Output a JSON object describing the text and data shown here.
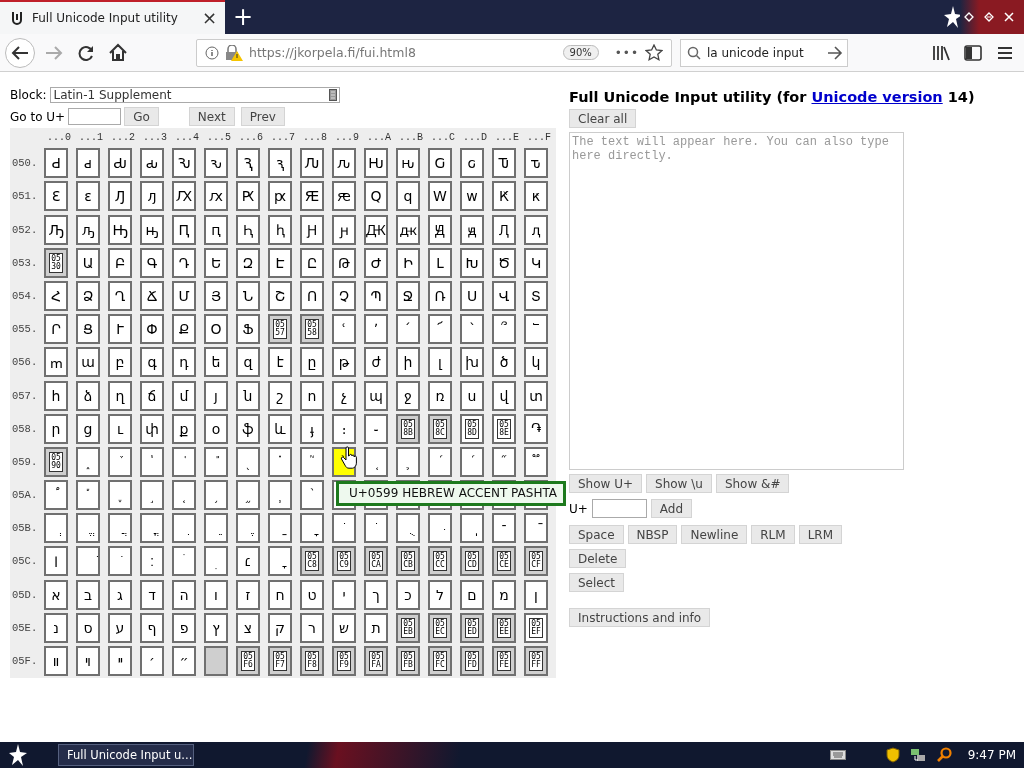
{
  "browser": {
    "tab": {
      "title": "Full Unicode Input utility",
      "close": "×",
      "selected": true
    },
    "new_tab": "+",
    "url": "https://jkorpela.fi/fui.html8",
    "zoom": "90%",
    "page_actions": "•••",
    "search": {
      "value": "la unicode input"
    }
  },
  "block": {
    "label": "Block:",
    "value": "Latin-1 Supplement"
  },
  "goto": {
    "label": "Go to U+",
    "button": "Go"
  },
  "nav_buttons": [
    "Next",
    "Prev"
  ],
  "grid": {
    "column_headers": [
      "...0",
      "...1",
      "...2",
      "...3",
      "...4",
      "...5",
      "...6",
      "...7",
      "...8",
      "...9",
      "...A",
      "...B",
      "...C",
      "...D",
      "...E",
      "...F"
    ],
    "rows": [
      {
        "label": "050.",
        "cells": [
          {
            "kind": "char",
            "text": "Ԁ",
            "hovered": false
          },
          {
            "kind": "char",
            "text": "ԁ",
            "hovered": false
          },
          {
            "kind": "char",
            "text": "Ԃ",
            "hovered": false
          },
          {
            "kind": "char",
            "text": "ԃ",
            "hovered": false
          },
          {
            "kind": "char",
            "text": "Ԅ",
            "hovered": false
          },
          {
            "kind": "char",
            "text": "ԅ",
            "hovered": false
          },
          {
            "kind": "char",
            "text": "Ԇ",
            "hovered": false
          },
          {
            "kind": "char",
            "text": "ԇ",
            "hovered": false
          },
          {
            "kind": "char",
            "text": "Ԉ",
            "hovered": false
          },
          {
            "kind": "char",
            "text": "ԉ",
            "hovered": false
          },
          {
            "kind": "char",
            "text": "Ԋ",
            "hovered": false
          },
          {
            "kind": "char",
            "text": "ԋ",
            "hovered": false
          },
          {
            "kind": "char",
            "text": "Ԍ",
            "hovered": false
          },
          {
            "kind": "char",
            "text": "ԍ",
            "hovered": false
          },
          {
            "kind": "char",
            "text": "Ԏ",
            "hovered": false
          },
          {
            "kind": "char",
            "text": "ԏ",
            "hovered": false
          }
        ]
      },
      {
        "label": "051.",
        "cells": [
          {
            "kind": "char",
            "text": "Ԑ",
            "hovered": false
          },
          {
            "kind": "char",
            "text": "ԑ",
            "hovered": false
          },
          {
            "kind": "char",
            "text": "Ԓ",
            "hovered": false
          },
          {
            "kind": "char",
            "text": "ԓ",
            "hovered": false
          },
          {
            "kind": "char",
            "text": "Ԕ",
            "hovered": false
          },
          {
            "kind": "char",
            "text": "ԕ",
            "hovered": false
          },
          {
            "kind": "char",
            "text": "Ԗ",
            "hovered": false
          },
          {
            "kind": "char",
            "text": "ԗ",
            "hovered": false
          },
          {
            "kind": "char",
            "text": "Ԙ",
            "hovered": false
          },
          {
            "kind": "char",
            "text": "ԙ",
            "hovered": false
          },
          {
            "kind": "char",
            "text": "Ԛ",
            "hovered": false
          },
          {
            "kind": "char",
            "text": "ԛ",
            "hovered": false
          },
          {
            "kind": "char",
            "text": "Ԝ",
            "hovered": false
          },
          {
            "kind": "char",
            "text": "ԝ",
            "hovered": false
          },
          {
            "kind": "char",
            "text": "Ԟ",
            "hovered": false
          },
          {
            "kind": "char",
            "text": "ԟ",
            "hovered": false
          }
        ]
      },
      {
        "label": "052.",
        "cells": [
          {
            "kind": "char",
            "text": "Ԡ",
            "hovered": false
          },
          {
            "kind": "char",
            "text": "ԡ",
            "hovered": false
          },
          {
            "kind": "char",
            "text": "Ԣ",
            "hovered": false
          },
          {
            "kind": "char",
            "text": "ԣ",
            "hovered": false
          },
          {
            "kind": "char",
            "text": "Ԥ",
            "hovered": false
          },
          {
            "kind": "char",
            "text": "ԥ",
            "hovered": false
          },
          {
            "kind": "char",
            "text": "Ԧ",
            "hovered": false
          },
          {
            "kind": "char",
            "text": "ԧ",
            "hovered": false
          },
          {
            "kind": "char",
            "text": "Ԩ",
            "hovered": false
          },
          {
            "kind": "char",
            "text": "ԩ",
            "hovered": false
          },
          {
            "kind": "char",
            "text": "Ԫ",
            "hovered": false
          },
          {
            "kind": "char",
            "text": "ԫ",
            "hovered": false
          },
          {
            "kind": "char",
            "text": "Ԭ",
            "hovered": false
          },
          {
            "kind": "char",
            "text": "ԭ",
            "hovered": false
          },
          {
            "kind": "char",
            "text": "Ԯ",
            "hovered": false
          },
          {
            "kind": "char",
            "text": "ԯ",
            "hovered": false
          }
        ]
      },
      {
        "label": "053.",
        "cells": [
          {
            "kind": "unassigned",
            "text": "05 30",
            "hovered": false
          },
          {
            "kind": "char",
            "text": "Ա",
            "hovered": false
          },
          {
            "kind": "char",
            "text": "Բ",
            "hovered": false
          },
          {
            "kind": "char",
            "text": "Գ",
            "hovered": false
          },
          {
            "kind": "char",
            "text": "Դ",
            "hovered": false
          },
          {
            "kind": "char",
            "text": "Ե",
            "hovered": false
          },
          {
            "kind": "char",
            "text": "Զ",
            "hovered": false
          },
          {
            "kind": "char",
            "text": "Է",
            "hovered": false
          },
          {
            "kind": "char",
            "text": "Ը",
            "hovered": false
          },
          {
            "kind": "char",
            "text": "Թ",
            "hovered": false
          },
          {
            "kind": "char",
            "text": "Ժ",
            "hovered": false
          },
          {
            "kind": "char",
            "text": "Ի",
            "hovered": false
          },
          {
            "kind": "char",
            "text": "Լ",
            "hovered": false
          },
          {
            "kind": "char",
            "text": "Խ",
            "hovered": false
          },
          {
            "kind": "char",
            "text": "Ծ",
            "hovered": false
          },
          {
            "kind": "char",
            "text": "Կ",
            "hovered": false
          }
        ]
      },
      {
        "label": "054.",
        "cells": [
          {
            "kind": "char",
            "text": "Հ",
            "hovered": false
          },
          {
            "kind": "char",
            "text": "Ձ",
            "hovered": false
          },
          {
            "kind": "char",
            "text": "Ղ",
            "hovered": false
          },
          {
            "kind": "char",
            "text": "Ճ",
            "hovered": false
          },
          {
            "kind": "char",
            "text": "Մ",
            "hovered": false
          },
          {
            "kind": "char",
            "text": "Յ",
            "hovered": false
          },
          {
            "kind": "char",
            "text": "Ն",
            "hovered": false
          },
          {
            "kind": "char",
            "text": "Շ",
            "hovered": false
          },
          {
            "kind": "char",
            "text": "Ո",
            "hovered": false
          },
          {
            "kind": "char",
            "text": "Չ",
            "hovered": false
          },
          {
            "kind": "char",
            "text": "Պ",
            "hovered": false
          },
          {
            "kind": "char",
            "text": "Ջ",
            "hovered": false
          },
          {
            "kind": "char",
            "text": "Ռ",
            "hovered": false
          },
          {
            "kind": "char",
            "text": "Ս",
            "hovered": false
          },
          {
            "kind": "char",
            "text": "Վ",
            "hovered": false
          },
          {
            "kind": "char",
            "text": "Տ",
            "hovered": false
          }
        ]
      },
      {
        "label": "055.",
        "cells": [
          {
            "kind": "char",
            "text": "Ր",
            "hovered": false
          },
          {
            "kind": "char",
            "text": "Ց",
            "hovered": false
          },
          {
            "kind": "char",
            "text": "Ւ",
            "hovered": false
          },
          {
            "kind": "char",
            "text": "Փ",
            "hovered": false
          },
          {
            "kind": "char",
            "text": "Ք",
            "hovered": false
          },
          {
            "kind": "char",
            "text": "Օ",
            "hovered": false
          },
          {
            "kind": "char",
            "text": "Ֆ",
            "hovered": false
          },
          {
            "kind": "unassigned",
            "text": "05 57",
            "hovered": false
          },
          {
            "kind": "unassigned",
            "text": "05 58",
            "hovered": false
          },
          {
            "kind": "char",
            "text": "ՙ",
            "hovered": false
          },
          {
            "kind": "char",
            "text": "՚",
            "hovered": false
          },
          {
            "kind": "char",
            "text": "՛",
            "hovered": false
          },
          {
            "kind": "char",
            "text": "՜",
            "hovered": false
          },
          {
            "kind": "char",
            "text": "՝",
            "hovered": false
          },
          {
            "kind": "char",
            "text": "՞",
            "hovered": false
          },
          {
            "kind": "char",
            "text": "՟",
            "hovered": false
          }
        ]
      },
      {
        "label": "056.",
        "cells": [
          {
            "kind": "char",
            "text": "ՠ",
            "hovered": false
          },
          {
            "kind": "char",
            "text": "ա",
            "hovered": false
          },
          {
            "kind": "char",
            "text": "բ",
            "hovered": false
          },
          {
            "kind": "char",
            "text": "գ",
            "hovered": false
          },
          {
            "kind": "char",
            "text": "դ",
            "hovered": false
          },
          {
            "kind": "char",
            "text": "ե",
            "hovered": false
          },
          {
            "kind": "char",
            "text": "զ",
            "hovered": false
          },
          {
            "kind": "char",
            "text": "է",
            "hovered": false
          },
          {
            "kind": "char",
            "text": "ը",
            "hovered": false
          },
          {
            "kind": "char",
            "text": "թ",
            "hovered": false
          },
          {
            "kind": "char",
            "text": "ժ",
            "hovered": false
          },
          {
            "kind": "char",
            "text": "ի",
            "hovered": false
          },
          {
            "kind": "char",
            "text": "լ",
            "hovered": false
          },
          {
            "kind": "char",
            "text": "խ",
            "hovered": false
          },
          {
            "kind": "char",
            "text": "ծ",
            "hovered": false
          },
          {
            "kind": "char",
            "text": "կ",
            "hovered": false
          }
        ]
      },
      {
        "label": "057.",
        "cells": [
          {
            "kind": "char",
            "text": "հ",
            "hovered": false
          },
          {
            "kind": "char",
            "text": "ձ",
            "hovered": false
          },
          {
            "kind": "char",
            "text": "ղ",
            "hovered": false
          },
          {
            "kind": "char",
            "text": "ճ",
            "hovered": false
          },
          {
            "kind": "char",
            "text": "մ",
            "hovered": false
          },
          {
            "kind": "char",
            "text": "յ",
            "hovered": false
          },
          {
            "kind": "char",
            "text": "ն",
            "hovered": false
          },
          {
            "kind": "char",
            "text": "շ",
            "hovered": false
          },
          {
            "kind": "char",
            "text": "ո",
            "hovered": false
          },
          {
            "kind": "char",
            "text": "չ",
            "hovered": false
          },
          {
            "kind": "char",
            "text": "պ",
            "hovered": false
          },
          {
            "kind": "char",
            "text": "ջ",
            "hovered": false
          },
          {
            "kind": "char",
            "text": "ռ",
            "hovered": false
          },
          {
            "kind": "char",
            "text": "ս",
            "hovered": false
          },
          {
            "kind": "char",
            "text": "վ",
            "hovered": false
          },
          {
            "kind": "char",
            "text": "տ",
            "hovered": false
          }
        ]
      },
      {
        "label": "058.",
        "cells": [
          {
            "kind": "char",
            "text": "ր",
            "hovered": false
          },
          {
            "kind": "char",
            "text": "ց",
            "hovered": false
          },
          {
            "kind": "char",
            "text": "ւ",
            "hovered": false
          },
          {
            "kind": "char",
            "text": "փ",
            "hovered": false
          },
          {
            "kind": "char",
            "text": "ք",
            "hovered": false
          },
          {
            "kind": "char",
            "text": "օ",
            "hovered": false
          },
          {
            "kind": "char",
            "text": "ֆ",
            "hovered": false
          },
          {
            "kind": "char",
            "text": "և",
            "hovered": false
          },
          {
            "kind": "char",
            "text": "ֈ",
            "hovered": false
          },
          {
            "kind": "char",
            "text": "։",
            "hovered": false
          },
          {
            "kind": "char",
            "text": "֊",
            "hovered": false
          },
          {
            "kind": "unassigned",
            "text": "05 8B",
            "hovered": false
          },
          {
            "kind": "unassigned",
            "text": "05 8C",
            "hovered": false
          },
          {
            "kind": "hex",
            "text": "05 8D",
            "hovered": false
          },
          {
            "kind": "hex",
            "text": "05 8E",
            "hovered": false
          },
          {
            "kind": "char",
            "text": "֏",
            "hovered": false
          }
        ]
      },
      {
        "label": "059.",
        "cells": [
          {
            "kind": "unassigned",
            "text": "05 90",
            "hovered": false
          },
          {
            "kind": "char",
            "text": "֑",
            "hovered": false
          },
          {
            "kind": "char",
            "text": "֒",
            "hovered": false
          },
          {
            "kind": "char",
            "text": "֓",
            "hovered": false
          },
          {
            "kind": "char",
            "text": "֔",
            "hovered": false
          },
          {
            "kind": "char",
            "text": "֕",
            "hovered": false
          },
          {
            "kind": "char",
            "text": "֖",
            "hovered": false
          },
          {
            "kind": "char",
            "text": "֗",
            "hovered": false
          },
          {
            "kind": "char",
            "text": "֘",
            "hovered": false
          },
          {
            "kind": "char",
            "text": "֙",
            "hovered": true
          },
          {
            "kind": "char",
            "text": "֚",
            "hovered": false
          },
          {
            "kind": "char",
            "text": "֛",
            "hovered": false
          },
          {
            "kind": "char",
            "text": "֜",
            "hovered": false
          },
          {
            "kind": "char",
            "text": "֝",
            "hovered": false
          },
          {
            "kind": "char",
            "text": "֞",
            "hovered": false
          },
          {
            "kind": "char",
            "text": "֟",
            "hovered": false
          }
        ]
      },
      {
        "label": "05A.",
        "cells": [
          {
            "kind": "char",
            "text": "֠",
            "hovered": false
          },
          {
            "kind": "char",
            "text": "֡",
            "hovered": false
          },
          {
            "kind": "char",
            "text": "֢",
            "hovered": false
          },
          {
            "kind": "char",
            "text": "֣",
            "hovered": false
          },
          {
            "kind": "char",
            "text": "֤",
            "hovered": false
          },
          {
            "kind": "char",
            "text": "֥",
            "hovered": false
          },
          {
            "kind": "char",
            "text": "֦",
            "hovered": false
          },
          {
            "kind": "char",
            "text": "֧",
            "hovered": false
          },
          {
            "kind": "char",
            "text": "֨",
            "hovered": false
          },
          {
            "kind": "covered",
            "hovered": false
          },
          {
            "kind": "covered",
            "hovered": false
          },
          {
            "kind": "covered",
            "hovered": false
          },
          {
            "kind": "covered",
            "hovered": false
          },
          {
            "kind": "covered",
            "hovered": false
          },
          {
            "kind": "covered",
            "hovered": false
          },
          {
            "kind": "covered",
            "hovered": false
          }
        ]
      },
      {
        "label": "05B.",
        "cells": [
          {
            "kind": "char",
            "text": "ְ",
            "hovered": false
          },
          {
            "kind": "char",
            "text": "ֱ",
            "hovered": false
          },
          {
            "kind": "char",
            "text": "ֲ",
            "hovered": false
          },
          {
            "kind": "char",
            "text": "ֳ",
            "hovered": false
          },
          {
            "kind": "char",
            "text": "ִ",
            "hovered": false
          },
          {
            "kind": "char",
            "text": "ֵ",
            "hovered": false
          },
          {
            "kind": "char",
            "text": "ֶ",
            "hovered": false
          },
          {
            "kind": "char",
            "text": "ַ",
            "hovered": false
          },
          {
            "kind": "char",
            "text": "ָ",
            "hovered": false
          },
          {
            "kind": "char",
            "text": "ֹ",
            "hovered": false
          },
          {
            "kind": "char",
            "text": "ֺ",
            "hovered": false
          },
          {
            "kind": "char",
            "text": "ֻ",
            "hovered": false
          },
          {
            "kind": "char",
            "text": "ּ",
            "hovered": false
          },
          {
            "kind": "char",
            "text": "ֽ",
            "hovered": false
          },
          {
            "kind": "char",
            "text": "־",
            "hovered": false
          },
          {
            "kind": "char",
            "text": "ֿ",
            "hovered": false
          }
        ]
      },
      {
        "label": "05C.",
        "cells": [
          {
            "kind": "char",
            "text": "׀",
            "hovered": false
          },
          {
            "kind": "char",
            "text": "ׁ",
            "hovered": false
          },
          {
            "kind": "char",
            "text": "ׂ",
            "hovered": false
          },
          {
            "kind": "char",
            "text": "׃",
            "hovered": false
          },
          {
            "kind": "char",
            "text": "ׄ",
            "hovered": false
          },
          {
            "kind": "char",
            "text": "ׅ",
            "hovered": false
          },
          {
            "kind": "char",
            "text": "׆",
            "hovered": false
          },
          {
            "kind": "char",
            "text": "ׇ",
            "hovered": false
          },
          {
            "kind": "unassigned",
            "text": "05 C8",
            "hovered": false
          },
          {
            "kind": "unassigned",
            "text": "05 C9",
            "hovered": false
          },
          {
            "kind": "unassigned",
            "text": "05 CA",
            "hovered": false
          },
          {
            "kind": "unassigned",
            "text": "05 CB",
            "hovered": false
          },
          {
            "kind": "unassigned",
            "text": "05 CC",
            "hovered": false
          },
          {
            "kind": "unassigned",
            "text": "05 CD",
            "hovered": false
          },
          {
            "kind": "unassigned",
            "text": "05 CE",
            "hovered": false
          },
          {
            "kind": "unassigned",
            "text": "05 CF",
            "hovered": false
          }
        ]
      },
      {
        "label": "05D.",
        "cells": [
          {
            "kind": "char",
            "text": "א",
            "hovered": false
          },
          {
            "kind": "char",
            "text": "ב",
            "hovered": false
          },
          {
            "kind": "char",
            "text": "ג",
            "hovered": false
          },
          {
            "kind": "char",
            "text": "ד",
            "hovered": false
          },
          {
            "kind": "char",
            "text": "ה",
            "hovered": false
          },
          {
            "kind": "char",
            "text": "ו",
            "hovered": false
          },
          {
            "kind": "char",
            "text": "ז",
            "hovered": false
          },
          {
            "kind": "char",
            "text": "ח",
            "hovered": false
          },
          {
            "kind": "char",
            "text": "ט",
            "hovered": false
          },
          {
            "kind": "char",
            "text": "י",
            "hovered": false
          },
          {
            "kind": "char",
            "text": "ך",
            "hovered": false
          },
          {
            "kind": "char",
            "text": "כ",
            "hovered": false
          },
          {
            "kind": "char",
            "text": "ל",
            "hovered": false
          },
          {
            "kind": "char",
            "text": "ם",
            "hovered": false
          },
          {
            "kind": "char",
            "text": "מ",
            "hovered": false
          },
          {
            "kind": "char",
            "text": "ן",
            "hovered": false
          }
        ]
      },
      {
        "label": "05E.",
        "cells": [
          {
            "kind": "char",
            "text": "נ",
            "hovered": false
          },
          {
            "kind": "char",
            "text": "ס",
            "hovered": false
          },
          {
            "kind": "char",
            "text": "ע",
            "hovered": false
          },
          {
            "kind": "char",
            "text": "ף",
            "hovered": false
          },
          {
            "kind": "char",
            "text": "פ",
            "hovered": false
          },
          {
            "kind": "char",
            "text": "ץ",
            "hovered": false
          },
          {
            "kind": "char",
            "text": "צ",
            "hovered": false
          },
          {
            "kind": "char",
            "text": "ק",
            "hovered": false
          },
          {
            "kind": "char",
            "text": "ר",
            "hovered": false
          },
          {
            "kind": "char",
            "text": "ש",
            "hovered": false
          },
          {
            "kind": "char",
            "text": "ת",
            "hovered": false
          },
          {
            "kind": "unassigned",
            "text": "05 EB",
            "hovered": false
          },
          {
            "kind": "unassigned",
            "text": "05 EC",
            "hovered": false
          },
          {
            "kind": "unassigned",
            "text": "05 ED",
            "hovered": false
          },
          {
            "kind": "unassigned",
            "text": "05 EE",
            "hovered": false
          },
          {
            "kind": "hex",
            "text": "05 EF",
            "hovered": false
          }
        ]
      },
      {
        "label": "05F.",
        "cells": [
          {
            "kind": "char",
            "text": "װ",
            "hovered": false
          },
          {
            "kind": "char",
            "text": "ױ",
            "hovered": false
          },
          {
            "kind": "char",
            "text": "ײ",
            "hovered": false
          },
          {
            "kind": "char",
            "text": "׳",
            "hovered": false
          },
          {
            "kind": "char",
            "text": "״",
            "hovered": false
          },
          {
            "kind": "empty",
            "hovered": false
          },
          {
            "kind": "unassigned",
            "text": "05 F6",
            "hovered": false
          },
          {
            "kind": "unassigned",
            "text": "05 F7",
            "hovered": false
          },
          {
            "kind": "unassigned",
            "text": "05 F8",
            "hovered": false
          },
          {
            "kind": "unassigned",
            "text": "05 F9",
            "hovered": false
          },
          {
            "kind": "unassigned",
            "text": "05 FA",
            "hovered": false
          },
          {
            "kind": "unassigned",
            "text": "05 FB",
            "hovered": false
          },
          {
            "kind": "unassigned",
            "text": "05 FC",
            "hovered": false
          },
          {
            "kind": "unassigned",
            "text": "05 FD",
            "hovered": false
          },
          {
            "kind": "unassigned",
            "text": "05 FE",
            "hovered": false
          },
          {
            "kind": "unassigned",
            "text": "05 FF",
            "hovered": false
          }
        ]
      }
    ]
  },
  "tooltip": "U+0599 HEBREW ACCENT PASHTA",
  "title": {
    "text": "Full Unicode Input utility (for ",
    "link": "Unicode version",
    "after": " 14)"
  },
  "clear_button": "Clear all",
  "output": {
    "placeholder": "The text will appear here. You can also type here directly."
  },
  "show_buttons": [
    "Show U+",
    "Show \\u",
    "Show &#"
  ],
  "add_row": {
    "label": "U+",
    "button": "Add"
  },
  "insert_buttons": [
    "Space",
    "NBSP",
    "Newline",
    "RLM",
    "LRM"
  ],
  "action_buttons": [
    "Delete",
    "Select"
  ],
  "info_button": "Instructions and info",
  "taskbar": {
    "task": "Full Unicode Input u...",
    "clock": "9:47 PM"
  }
}
